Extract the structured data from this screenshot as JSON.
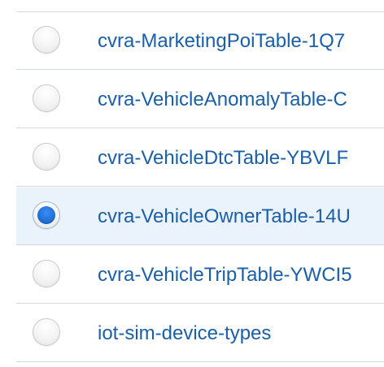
{
  "table": {
    "rows": [
      {
        "name": "cvra-MarketingPoiTable-1Q7",
        "selected": false
      },
      {
        "name": "cvra-VehicleAnomalyTable-C",
        "selected": false
      },
      {
        "name": "cvra-VehicleDtcTable-YBVLF",
        "selected": false
      },
      {
        "name": "cvra-VehicleOwnerTable-14U",
        "selected": true
      },
      {
        "name": "cvra-VehicleTripTable-YWCI5",
        "selected": false
      },
      {
        "name": "iot-sim-device-types",
        "selected": false
      }
    ]
  },
  "colors": {
    "link": "#1a5fa7",
    "selected_row_bg": "#eaf3fb",
    "radio_selected": "#1f6fd8",
    "divider": "#d5dbdb"
  }
}
